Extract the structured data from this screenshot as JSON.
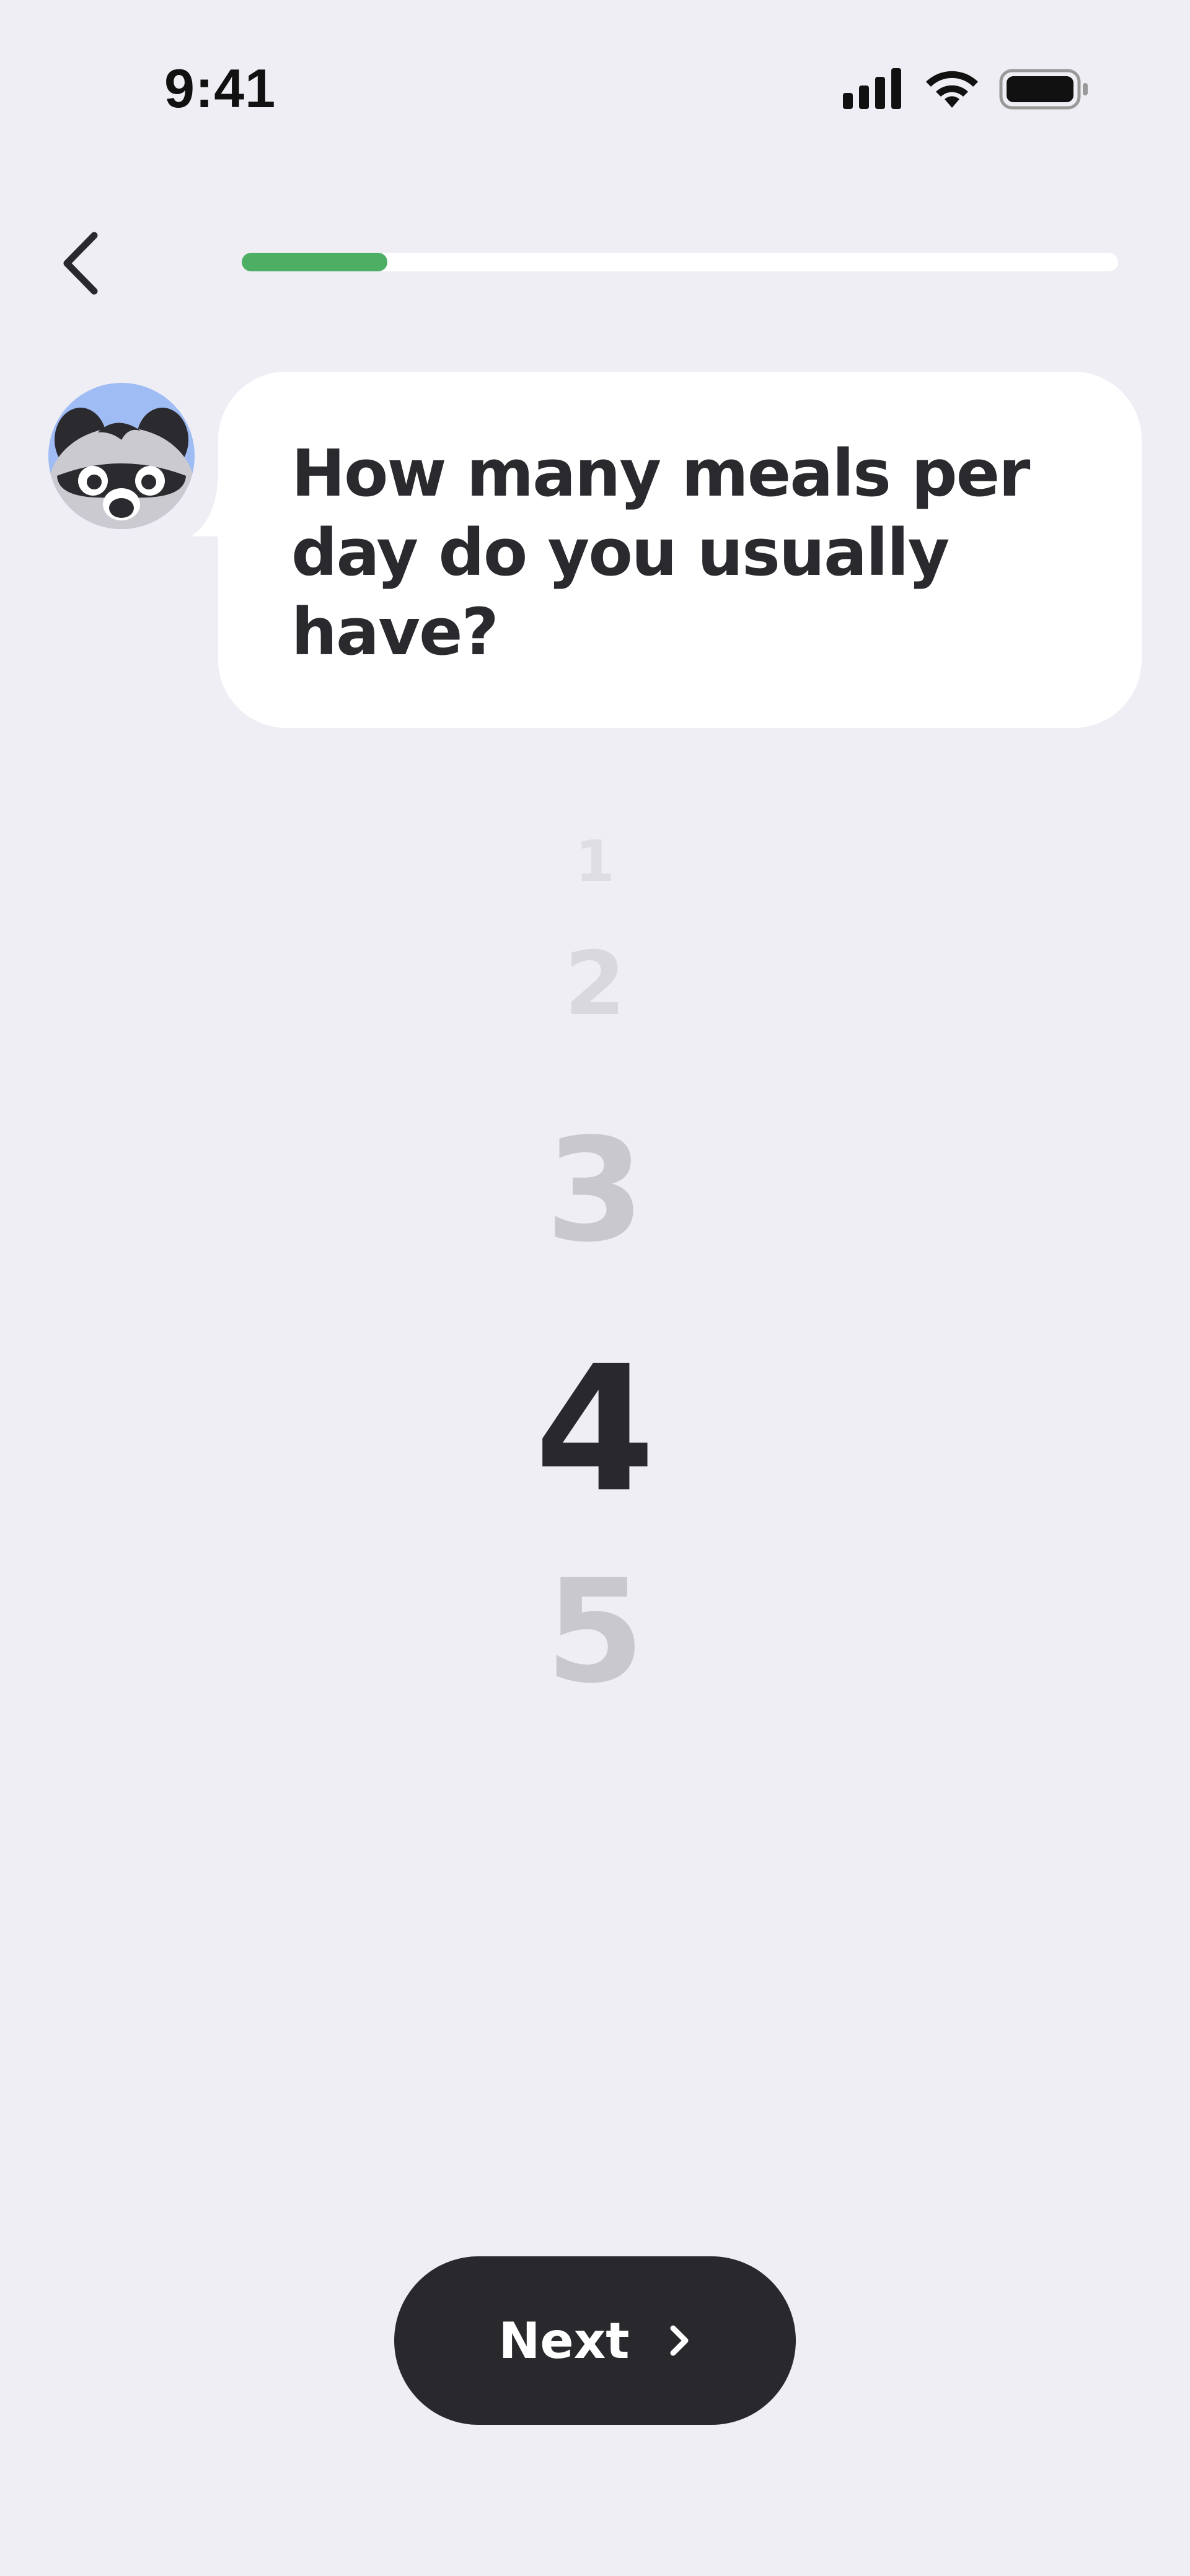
{
  "status_bar": {
    "time": "9:41"
  },
  "navigation": {
    "back_icon": "chevron-left-icon",
    "progress_fraction": 0.166,
    "progress_color": "#4CAF63"
  },
  "question": {
    "text": "How many meals per day do you usually have?",
    "avatar_icon": "raccoon-avatar-icon",
    "avatar_bg": "#9FBCF5"
  },
  "picker": {
    "options": [
      "1",
      "2",
      "3",
      "4",
      "5"
    ],
    "selected": "4"
  },
  "footer": {
    "next_label": "Next",
    "next_icon": "chevron-right-icon"
  },
  "colors": {
    "background": "#EFEEF4",
    "text_dark": "#29292D",
    "text_faded": "#C9C8CF"
  }
}
